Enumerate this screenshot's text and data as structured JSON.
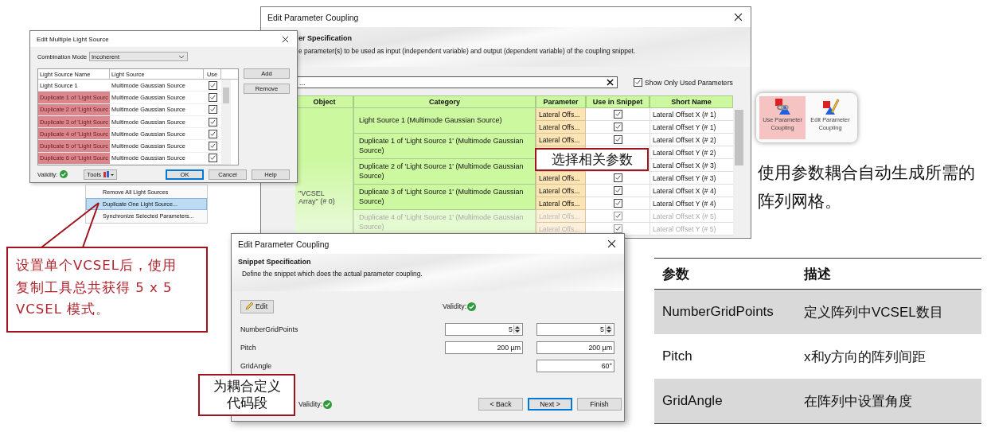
{
  "back_window": {
    "title": "Edit Parameter Coupling",
    "heading": "er Specification",
    "description": "e parameter(s) to be used as input (independent variable) and output (dependent variable) of the coupling snippet.",
    "search": {
      "value": "..."
    },
    "show_only_used": {
      "label": "Show Only Used Parameters",
      "checked": true
    },
    "table": {
      "columns": [
        "Object",
        "Category",
        "Parameter",
        "Use in Snippet",
        "Short Name"
      ],
      "object": "\"VCSEL Array\" (# 0)",
      "groups": [
        {
          "category": "Light Source 1 (Multimode Gaussian Source)",
          "faded": false,
          "rows": [
            {
              "parameter": "Lateral Offs...",
              "use": true,
              "short_name": "Lateral Offset X (# 1)"
            },
            {
              "parameter": "Lateral Offs...",
              "use": true,
              "short_name": "Lateral Offset Y (# 1)"
            }
          ]
        },
        {
          "category": "Duplicate 1 of 'Light Source 1' (Multimode Gaussian Source)",
          "faded": false,
          "rows": [
            {
              "parameter": "Lateral Offs...",
              "use": true,
              "short_name": "Lateral Offset X (# 2)"
            },
            {
              "short_name": "Lateral Offset Y (# 2)"
            }
          ]
        },
        {
          "category": "Duplicate 2 of 'Light Source 1' (Multimode Gaussian Source)",
          "faded": false,
          "rows": [
            {
              "short_name": "Lateral Offset X (# 3)"
            },
            {
              "parameter": "Lateral Offs...",
              "use": true,
              "short_name": "Lateral Offset Y (# 3)"
            }
          ]
        },
        {
          "category": "Duplicate 3 of 'Light Source 1' (Multimode Gaussian Source)",
          "faded": false,
          "rows": [
            {
              "parameter": "Lateral Offs...",
              "use": true,
              "short_name": "Lateral Offset X (# 4)"
            },
            {
              "parameter": "Lateral Offs...",
              "use": true,
              "short_name": "Lateral Offset Y (# 4)"
            }
          ]
        },
        {
          "category": "Duplicate 4 of 'Light Source 1' (Multimode Gaussian Source)",
          "faded": true,
          "rows": [
            {
              "parameter": "Lateral Offs...",
              "use": true,
              "short_name": "Lateral Offset X (# 5)"
            },
            {
              "parameter": "Lateral Offs...",
              "use": true,
              "short_name": "Lateral Offset Y (# 5)"
            }
          ]
        }
      ]
    }
  },
  "light_dialog": {
    "title": "Edit Multiple Light Source",
    "combination_mode": {
      "label": "Combination Mode",
      "value": "Incoherent"
    },
    "columns": [
      "Light Source Name",
      "Light Source",
      "Use"
    ],
    "rows": [
      {
        "name": "Light Source 1",
        "source": "Multimode Gaussian Source",
        "checked": true,
        "highlighted": false
      },
      {
        "name": "Duplicate 1 of 'Light Sourc",
        "source": "Multimode Gaussian Source",
        "checked": true,
        "highlighted": true
      },
      {
        "name": "Duplicate 2 of 'Light Sourc",
        "source": "Multimode Gaussian Source",
        "checked": true,
        "highlighted": true
      },
      {
        "name": "Duplicate 3 of 'Light Sourc",
        "source": "Multimode Gaussian Source",
        "checked": true,
        "highlighted": true
      },
      {
        "name": "Duplicate 4 of 'Light Sourc",
        "source": "Multimode Gaussian Source",
        "checked": true,
        "highlighted": true
      },
      {
        "name": "Duplicate 5 of 'Light Sourc",
        "source": "Multimode Gaussian Source",
        "checked": true,
        "highlighted": true
      },
      {
        "name": "Duplicate 6 of 'Light Sourc",
        "source": "Multimode Gaussian Source",
        "checked": true,
        "highlighted": true
      }
    ],
    "side_buttons": [
      "Add",
      "Remove"
    ],
    "validity_label": "Validity:",
    "tools_label": "Tools",
    "buttons": [
      {
        "label": "OK",
        "default": true
      },
      {
        "label": "Cancel",
        "default": false
      },
      {
        "label": "Help",
        "default": false
      }
    ]
  },
  "context_menu": [
    {
      "label": "Remove All Light Sources",
      "selected": false
    },
    {
      "label": "Duplicate One Light Source...",
      "selected": true
    },
    {
      "label": "Synchronize Selected Parameters...",
      "selected": false
    }
  ],
  "callout_duplicate": "设置单个VCSEL后，使用复制工具总共获得 5 x 5 VCSEL 模式。",
  "callout_params": "选择相关参数",
  "callout_snippet": "为耦合定义代码段",
  "snippet_dialog": {
    "title": "Edit Parameter Coupling",
    "heading": "Snippet Specification",
    "description": "Define the snippet which does the actual parameter coupling.",
    "edit_button": "Edit",
    "validity_label": "Validity:",
    "params": [
      {
        "kind": "spinner",
        "name": "NumberGridPoints",
        "values": [
          "5",
          "5"
        ]
      },
      {
        "kind": "text",
        "name": "Pitch",
        "values": [
          "200 µm",
          "200 µm"
        ]
      },
      {
        "kind": "text",
        "name": "GridAngle",
        "values": [
          "60°"
        ]
      }
    ],
    "footer_validity": "Validity:",
    "buttons": [
      {
        "label": "< Back",
        "default": false
      },
      {
        "label": "Next >",
        "default": true
      },
      {
        "label": "Finish",
        "default": false
      }
    ]
  },
  "ribbon": [
    {
      "kind": "use",
      "label": "Use Parameter Coupling",
      "selected": true
    },
    {
      "kind": "edit",
      "label": "Edit Parameter Coupling",
      "selected": false
    }
  ],
  "summary": "使用参数耦合自动生成所需的阵列网格。",
  "param_table": {
    "columns": [
      "参数",
      "描述"
    ],
    "rows": [
      {
        "name": "NumberGridPoints",
        "description": "定义阵列中VCSEL数目"
      },
      {
        "name": "Pitch",
        "description": "x和y方向的阵列间距"
      },
      {
        "name": "GridAngle",
        "description": "在阵列中设置角度"
      }
    ]
  }
}
